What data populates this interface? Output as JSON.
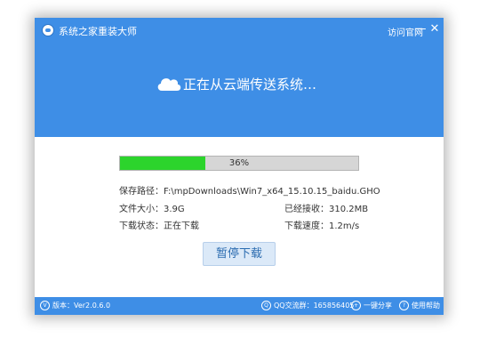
{
  "titlebar": {
    "app_title": "系统之家重装大师",
    "official_link": "访问官网",
    "minimize_glyph": "—",
    "close_glyph": "✕"
  },
  "header": {
    "status_text": "正在从云端传送系统…"
  },
  "progress": {
    "percent": 36,
    "label": "36%",
    "fill_color": "#2cd42c"
  },
  "info": {
    "save_path": "保存路径：F:\\mpDownloads\\Win7_x64_15.10.15_baidu.GHO",
    "file_size": "文件大小：3.9G",
    "received": "已经接收：310.2MB",
    "download_status": "下载状态：正在下载",
    "download_speed": "下载速度：1.2m/s"
  },
  "pause_button": {
    "label": "暂停下载"
  },
  "footer": {
    "version": "版本：Ver2.0.6.0",
    "qq_group": "QQ交流群：165856405",
    "share": "一键分享",
    "help": "使用帮助",
    "version_icon": "V",
    "qq_icon": "Q",
    "share_icon": "+",
    "help_icon": "?"
  },
  "colors": {
    "header_blue": "#3e8ee6",
    "progress_green": "#2cd42c",
    "button_text": "#2b6cb0"
  },
  "icons": {
    "logo": "app-logo-icon",
    "cloud": "cloud-icon",
    "minimize": "minimize-icon",
    "close": "close-icon"
  }
}
